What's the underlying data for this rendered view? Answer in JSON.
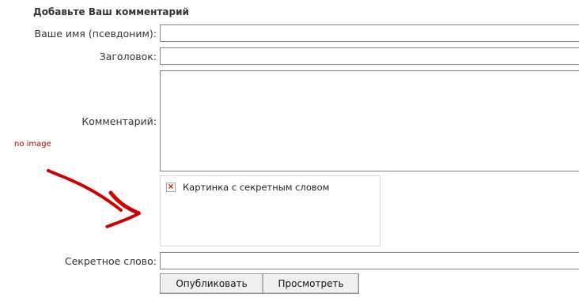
{
  "form": {
    "title": "Добавьте Ваш комментарий",
    "name_label": "Ваше имя (псевдоним):",
    "name_value": "",
    "subject_label": "Заголовок:",
    "subject_value": "",
    "comment_label": "Комментарий:",
    "comment_value": "",
    "captcha_alt": "Картинка с секретным словом",
    "secret_label": "Секретное слово:",
    "secret_value": "",
    "publish_button": "Опубликовать",
    "preview_button": "Просмотреть"
  },
  "annotation": {
    "no_image_text": "no image",
    "arrow_color": "#cc0000"
  },
  "icons": {
    "broken_image": "broken-image-icon"
  }
}
